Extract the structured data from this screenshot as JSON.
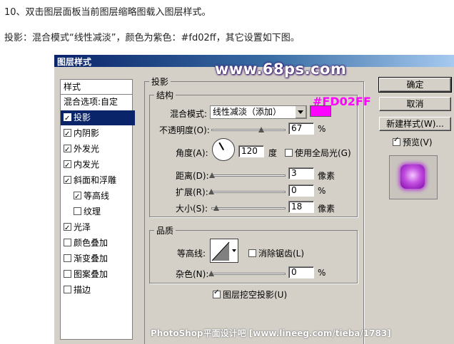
{
  "intro": {
    "line1": "10、双击图层面板当前图层缩略图载入图层样式。",
    "line2": "投影：混合模式“线性减淡”，颜色为紫色：#fd02ff，其它设置如下图。"
  },
  "dialog": {
    "title": "图层样式",
    "watermark": "www.68ps.com",
    "footer": "PhotoShop平面设计吧  [www.lineeg.com/tieba/1783]"
  },
  "styles": {
    "header": "样式",
    "blend_options": "混合选项:自定",
    "items": [
      {
        "label": "投影",
        "checked": true,
        "selected": true
      },
      {
        "label": "内阴影",
        "checked": true
      },
      {
        "label": "外发光",
        "checked": true
      },
      {
        "label": "内发光",
        "checked": true
      },
      {
        "label": "斜面和浮雕",
        "checked": true
      },
      {
        "label": "等高线",
        "checked": true,
        "indent": true
      },
      {
        "label": "纹理",
        "checked": false,
        "indent": true
      },
      {
        "label": "光泽",
        "checked": true
      },
      {
        "label": "颜色叠加",
        "checked": false
      },
      {
        "label": "渐变叠加",
        "checked": false
      },
      {
        "label": "图案叠加",
        "checked": false
      },
      {
        "label": "描边",
        "checked": false
      }
    ]
  },
  "shadow": {
    "group_title": "投影",
    "structure_title": "结构",
    "blend_mode_label": "混合模式:",
    "blend_mode_value": "线性减淡（添加）",
    "color_hex": "#FD02FF",
    "color": "#fd02ff",
    "opacity_label": "不透明度(O):",
    "opacity_value": "67",
    "opacity_unit": "%",
    "angle_label": "角度(A):",
    "angle_value": "120",
    "angle_unit": "度",
    "global_light_label": "使用全局光(G)",
    "distance_label": "距离(D):",
    "distance_value": "3",
    "distance_unit": "像素",
    "spread_label": "扩展(R):",
    "spread_value": "0",
    "spread_unit": "%",
    "size_label": "大小(S):",
    "size_value": "18",
    "size_unit": "像素",
    "quality_title": "品质",
    "contour_label": "等高线:",
    "antialias_label": "消除锯齿(L)",
    "noise_label": "杂色(N):",
    "noise_value": "0",
    "noise_unit": "%",
    "knockout_label": "图层挖空投影(U)"
  },
  "buttons": {
    "ok": "确定",
    "cancel": "取消",
    "new_style": "新建样式(W)...",
    "preview_label": "预览(V)"
  }
}
